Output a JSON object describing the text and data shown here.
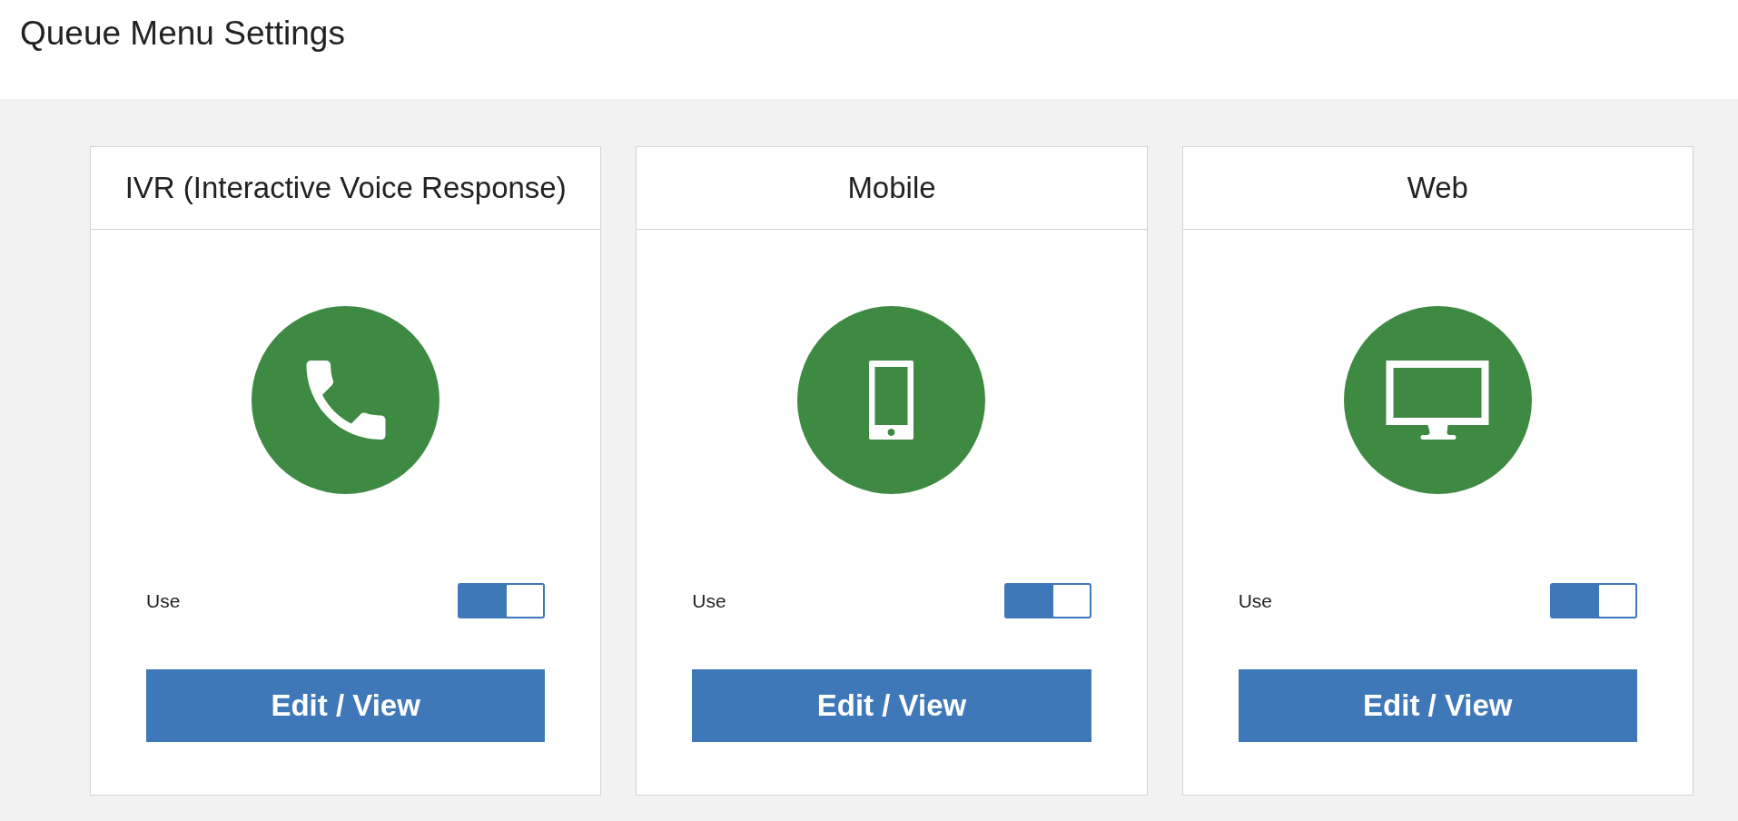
{
  "page": {
    "title": "Queue Menu Settings"
  },
  "channels": [
    {
      "name": "IVR (Interactive Voice Response)",
      "kind": "phone",
      "use_label": "Use",
      "on": true,
      "button": "Edit / View"
    },
    {
      "name": "Mobile",
      "kind": "mobile",
      "use_label": "Use",
      "on": true,
      "button": "Edit / View"
    },
    {
      "name": "Web",
      "kind": "web",
      "use_label": "Use",
      "on": true,
      "button": "Edit / View"
    }
  ]
}
